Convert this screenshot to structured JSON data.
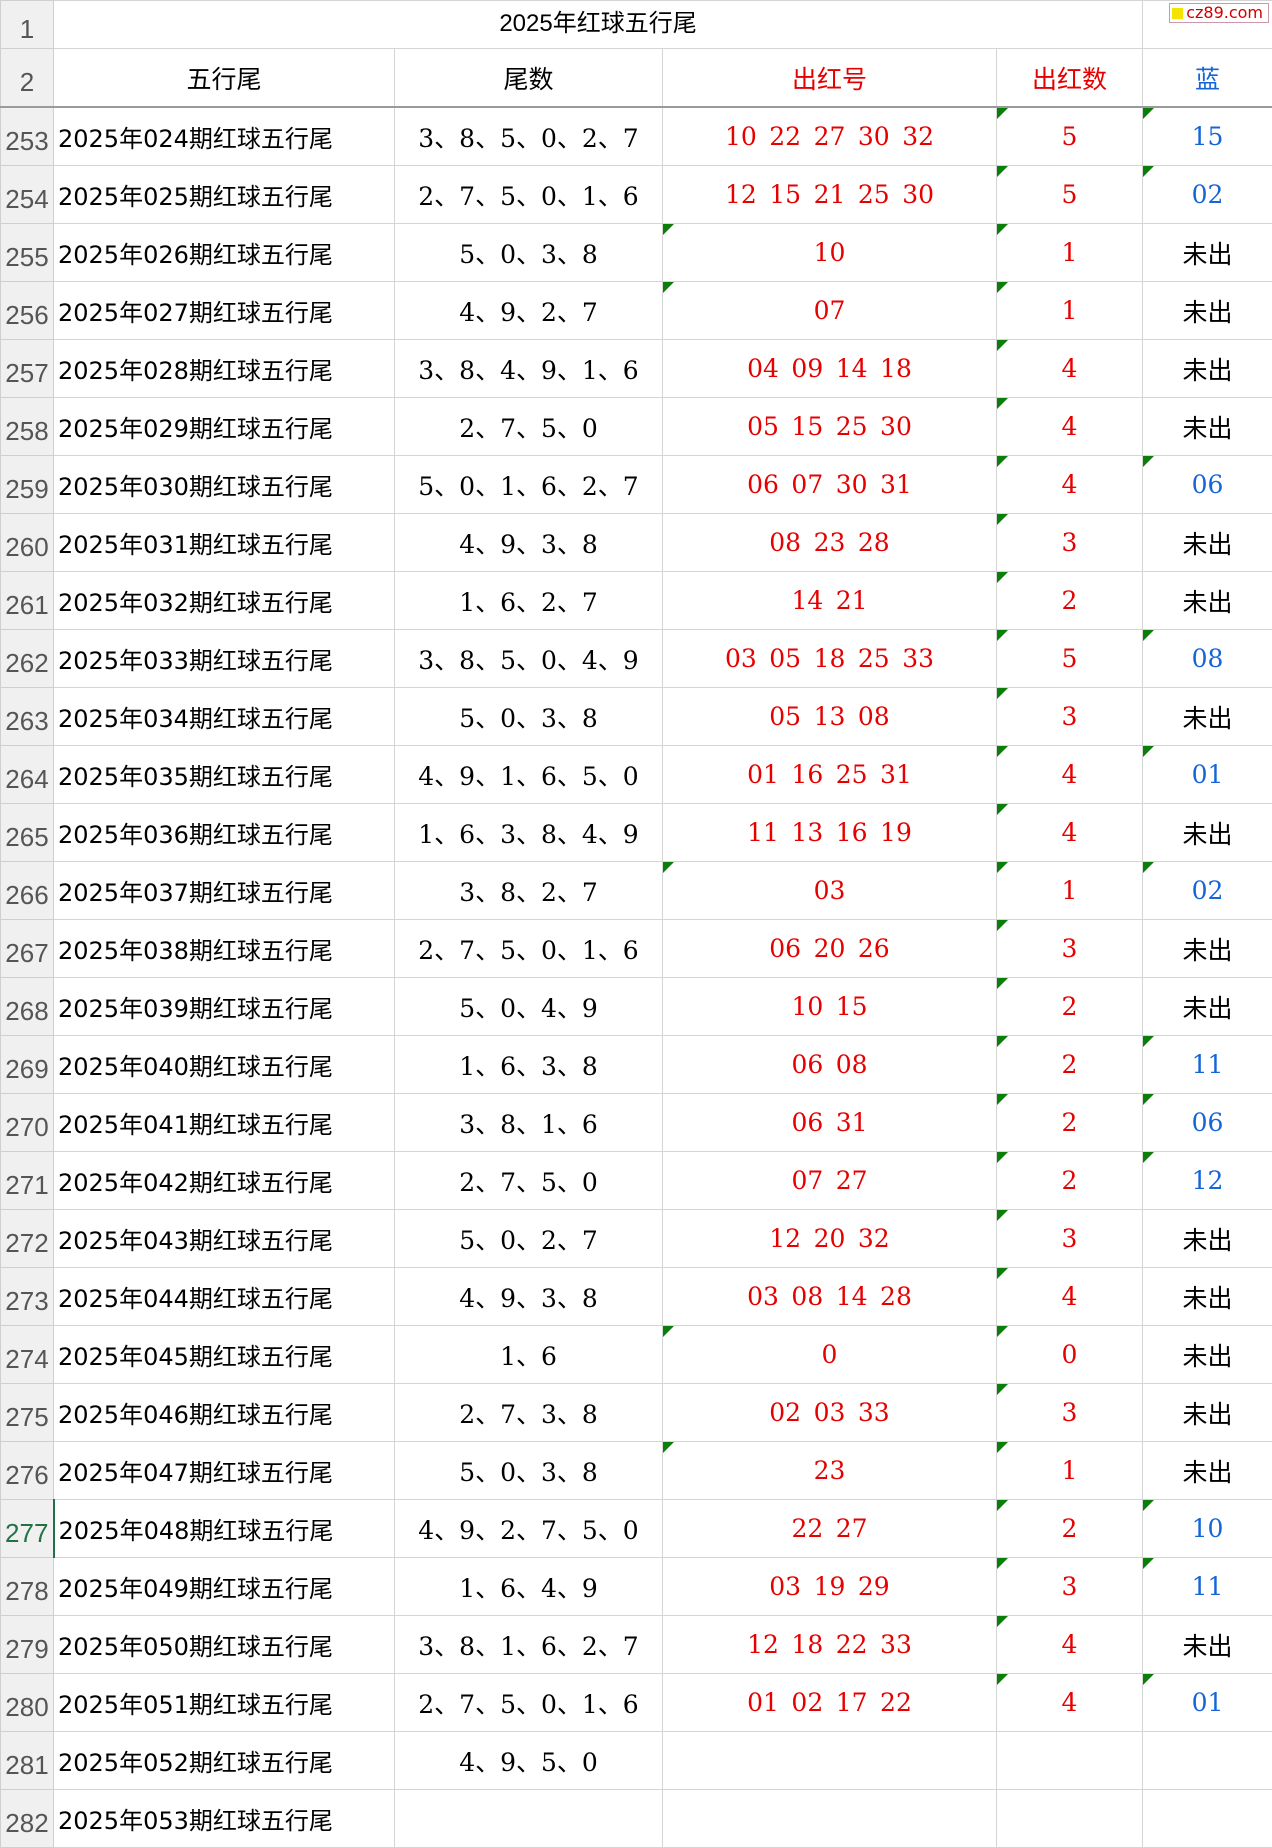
{
  "sheet": {
    "title": "2025年红球五行尾",
    "title_row_number": "1",
    "header_row_number": "2",
    "watermark": "cz89.com",
    "headers": {
      "period": "五行尾",
      "tails": "尾数",
      "red_numbers": "出红号",
      "red_count": "出红数",
      "blue": "蓝"
    },
    "colors": {
      "red": "#e60000",
      "blue": "#1565d8",
      "marker_green": "#0a7d0a",
      "active_row": "#217346"
    },
    "active_row": "277",
    "rows": [
      {
        "n": "253",
        "period": "2025年024期红球五行尾",
        "tails": "3、8、5、0、2、7",
        "reds": "10 22 27 30 32",
        "count": "5",
        "blue": "15"
      },
      {
        "n": "254",
        "period": "2025年025期红球五行尾",
        "tails": "2、7、5、0、1、6",
        "reds": "12 15 21 25 30",
        "count": "5",
        "blue": "02"
      },
      {
        "n": "255",
        "period": "2025年026期红球五行尾",
        "tails": "5、0、3、8",
        "reds": "10",
        "count": "1",
        "blue": "未出"
      },
      {
        "n": "256",
        "period": "2025年027期红球五行尾",
        "tails": "4、9、2、7",
        "reds": "07",
        "count": "1",
        "blue": "未出"
      },
      {
        "n": "257",
        "period": "2025年028期红球五行尾",
        "tails": "3、8、4、9、1、6",
        "reds": "04 09 14 18",
        "count": "4",
        "blue": "未出"
      },
      {
        "n": "258",
        "period": "2025年029期红球五行尾",
        "tails": "2、7、5、0",
        "reds": "05 15 25 30",
        "count": "4",
        "blue": "未出"
      },
      {
        "n": "259",
        "period": "2025年030期红球五行尾",
        "tails": "5、0、1、6、2、7",
        "reds": "06 07 30 31",
        "count": "4",
        "blue": "06"
      },
      {
        "n": "260",
        "period": "2025年031期红球五行尾",
        "tails": "4、9、3、8",
        "reds": "08 23 28",
        "count": "3",
        "blue": "未出"
      },
      {
        "n": "261",
        "period": "2025年032期红球五行尾",
        "tails": "1、6、2、7",
        "reds": "14 21",
        "count": "2",
        "blue": "未出"
      },
      {
        "n": "262",
        "period": "2025年033期红球五行尾",
        "tails": "3、8、5、0、4、9",
        "reds": "03 05 18 25 33",
        "count": "5",
        "blue": "08"
      },
      {
        "n": "263",
        "period": "2025年034期红球五行尾",
        "tails": "5、0、3、8",
        "reds": "05 13 08",
        "count": "3",
        "blue": "未出"
      },
      {
        "n": "264",
        "period": "2025年035期红球五行尾",
        "tails": "4、9、1、6、5、0",
        "reds": "01 16 25 31",
        "count": "4",
        "blue": "01"
      },
      {
        "n": "265",
        "period": "2025年036期红球五行尾",
        "tails": "1、6、3、8、4、9",
        "reds": "11 13 16 19",
        "count": "4",
        "blue": "未出"
      },
      {
        "n": "266",
        "period": "2025年037期红球五行尾",
        "tails": "3、8、2、7",
        "reds": "03",
        "count": "1",
        "blue": "02"
      },
      {
        "n": "267",
        "period": "2025年038期红球五行尾",
        "tails": "2、7、5、0、1、6",
        "reds": "06 20 26",
        "count": "3",
        "blue": "未出"
      },
      {
        "n": "268",
        "period": "2025年039期红球五行尾",
        "tails": "5、0、4、9",
        "reds": "10 15",
        "count": "2",
        "blue": "未出"
      },
      {
        "n": "269",
        "period": "2025年040期红球五行尾",
        "tails": "1、6、3、8",
        "reds": "06 08",
        "count": "2",
        "blue": "11"
      },
      {
        "n": "270",
        "period": "2025年041期红球五行尾",
        "tails": "3、8、1、6",
        "reds": "06 31",
        "count": "2",
        "blue": "06"
      },
      {
        "n": "271",
        "period": "2025年042期红球五行尾",
        "tails": "2、7、5、0",
        "reds": "07 27",
        "count": "2",
        "blue": "12"
      },
      {
        "n": "272",
        "period": "2025年043期红球五行尾",
        "tails": "5、0、2、7",
        "reds": "12 20 32",
        "count": "3",
        "blue": "未出"
      },
      {
        "n": "273",
        "period": "2025年044期红球五行尾",
        "tails": "4、9、3、8",
        "reds": "03 08 14 28",
        "count": "4",
        "blue": "未出"
      },
      {
        "n": "274",
        "period": "2025年045期红球五行尾",
        "tails": "1、6",
        "reds": "0",
        "count": "0",
        "blue": "未出"
      },
      {
        "n": "275",
        "period": "2025年046期红球五行尾",
        "tails": "2、7、3、8",
        "reds": "02 03 33",
        "count": "3",
        "blue": "未出"
      },
      {
        "n": "276",
        "period": "2025年047期红球五行尾",
        "tails": "5、0、3、8",
        "reds": "23",
        "count": "1",
        "blue": "未出"
      },
      {
        "n": "277",
        "period": "2025年048期红球五行尾",
        "tails": "4、9、2、7、5、0",
        "reds": "22 27",
        "count": "2",
        "blue": "10"
      },
      {
        "n": "278",
        "period": "2025年049期红球五行尾",
        "tails": "1、6、4、9",
        "reds": "03 19 29",
        "count": "3",
        "blue": "11"
      },
      {
        "n": "279",
        "period": "2025年050期红球五行尾",
        "tails": "3、8、1、6、2、7",
        "reds": "12 18 22 33",
        "count": "4",
        "blue": "未出"
      },
      {
        "n": "280",
        "period": "2025年051期红球五行尾",
        "tails": "2、7、5、0、1、6",
        "reds": "01 02 17 22",
        "count": "4",
        "blue": "01"
      },
      {
        "n": "281",
        "period": "2025年052期红球五行尾",
        "tails": "4、9、5、0",
        "reds": "",
        "count": "",
        "blue": ""
      },
      {
        "n": "282",
        "period": "2025年053期红球五行尾",
        "tails": "",
        "reds": "",
        "count": "",
        "blue": ""
      }
    ]
  }
}
